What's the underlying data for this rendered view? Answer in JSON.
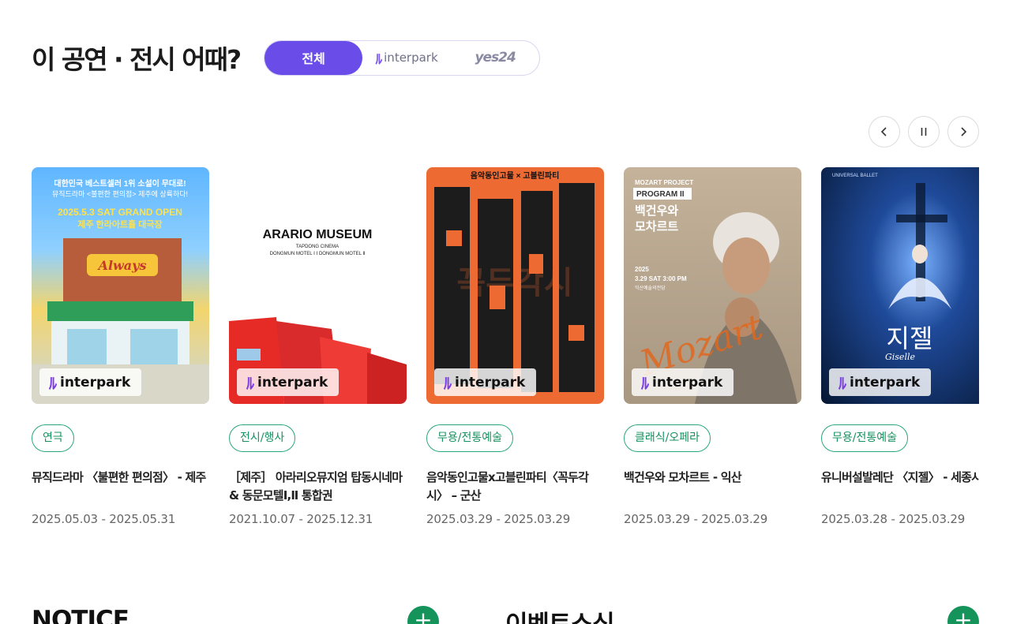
{
  "section": {
    "title": "이 공연 · 전시 어때?"
  },
  "vendor_tabs": [
    {
      "label": "전체",
      "active": true
    },
    {
      "label": "interpark",
      "active": false
    },
    {
      "label": "yes24",
      "active": false
    }
  ],
  "controls": {
    "prev": "prev",
    "pause": "pause",
    "next": "next"
  },
  "cards": [
    {
      "poster_lines": [
        "대한민국 베스트셀러 1위 소설이 무대로!",
        "뮤직드라마 <불편한 편의점> 제주에 상륙하다!",
        "2025.5.3 SAT GRAND OPEN",
        "제주 한라아트홀 대극장",
        "Always"
      ],
      "badge": "interpark",
      "genre": "연극",
      "title": "뮤직드라마 〈불편한 편의점〉 - 제주",
      "date": "2025.05.03 - 2025.05.31"
    },
    {
      "poster_lines": [
        "ARARIO MUSEUM",
        "TAPDONG CINEMA",
        "DONGMUN MOTEL Ⅰ Ⅰ DONGMUN MOTEL Ⅱ"
      ],
      "badge": "interpark",
      "genre": "전시/행사",
      "title": "［제주］ 아라리오뮤지엄 탑동시네마 & 동문모텔Ⅰ,Ⅱ 통합권",
      "date": "2021.10.07 - 2025.12.31"
    },
    {
      "poster_lines": [
        "음악동인고물 × 고블린파티",
        "꼭두각시"
      ],
      "badge": "interpark",
      "genre": "무용/전통예술",
      "title": "음악동인고물x고블린파티〈꼭두각시〉 – 군산",
      "date": "2025.03.29 - 2025.03.29"
    },
    {
      "poster_lines": [
        "MOZART PROJECT",
        "PROGRAM II",
        "백건우와",
        "모차르트",
        "2025",
        "3.29 SAT 3:00 PM",
        "익산예술의전당",
        "Mozart"
      ],
      "badge": "interpark",
      "genre": "클래식/오페라",
      "title": "백건우와 모차르트 - 익산",
      "date": "2025.03.29 - 2025.03.29"
    },
    {
      "poster_lines": [
        "UNIVERSAL BALLET",
        "지젤",
        "Giselle"
      ],
      "badge": "interpark",
      "genre": "무용/전통예술",
      "title": "유니버설발레단 〈지젤〉 - 세종시",
      "date": "2025.03.28 - 2025.03.29"
    }
  ],
  "bottom": {
    "notice_title": "NOTICE",
    "event_title": "이벤트소식",
    "plus": "+"
  },
  "colors": {
    "accent": "#6a4ce8",
    "genre": "#16905f",
    "plus": "#14935b"
  }
}
